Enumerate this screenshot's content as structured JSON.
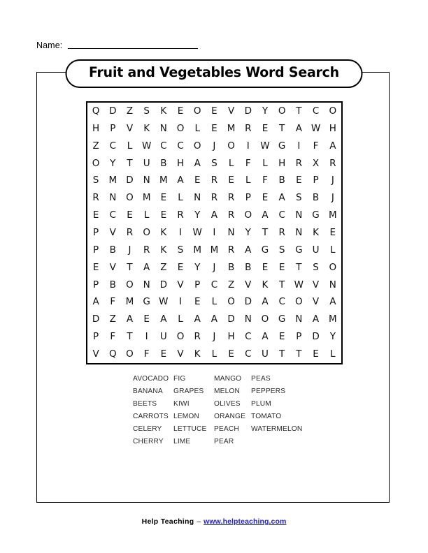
{
  "name_field": {
    "label": "Name:",
    "value": ""
  },
  "title": "Fruit and Vegetables Word Search",
  "grid": {
    "rows": 15,
    "cols": 15,
    "letters": [
      [
        "Q",
        "D",
        "Z",
        "S",
        "K",
        "E",
        "O",
        "E",
        "V",
        "D",
        "Y",
        "O",
        "T",
        "C",
        "O"
      ],
      [
        "H",
        "P",
        "V",
        "K",
        "N",
        "O",
        "L",
        "E",
        "M",
        "R",
        "E",
        "T",
        "A",
        "W",
        "H"
      ],
      [
        "Z",
        "C",
        "L",
        "W",
        "C",
        "C",
        "O",
        "J",
        "O",
        "I",
        "W",
        "G",
        "I",
        "F",
        "A"
      ],
      [
        "O",
        "Y",
        "T",
        "U",
        "B",
        "H",
        "A",
        "S",
        "L",
        "F",
        "L",
        "H",
        "R",
        "X",
        "R"
      ],
      [
        "S",
        "M",
        "D",
        "N",
        "M",
        "A",
        "E",
        "R",
        "E",
        "L",
        "F",
        "B",
        "E",
        "P",
        "J"
      ],
      [
        "R",
        "N",
        "O",
        "M",
        "E",
        "L",
        "N",
        "R",
        "R",
        "P",
        "E",
        "A",
        "S",
        "B",
        "J"
      ],
      [
        "E",
        "C",
        "E",
        "L",
        "E",
        "R",
        "Y",
        "A",
        "R",
        "O",
        "A",
        "C",
        "N",
        "G",
        "M"
      ],
      [
        "P",
        "V",
        "R",
        "O",
        "K",
        "I",
        "W",
        "I",
        "N",
        "Y",
        "T",
        "R",
        "N",
        "K",
        "E"
      ],
      [
        "P",
        "B",
        "J",
        "R",
        "K",
        "S",
        "M",
        "M",
        "R",
        "A",
        "G",
        "S",
        "G",
        "U",
        "L"
      ],
      [
        "E",
        "V",
        "T",
        "A",
        "Z",
        "E",
        "Y",
        "J",
        "B",
        "B",
        "E",
        "E",
        "T",
        "S",
        "O"
      ],
      [
        "P",
        "B",
        "O",
        "N",
        "D",
        "V",
        "P",
        "C",
        "Z",
        "V",
        "K",
        "T",
        "W",
        "V",
        "N"
      ],
      [
        "A",
        "F",
        "M",
        "G",
        "W",
        "I",
        "E",
        "L",
        "O",
        "D",
        "A",
        "C",
        "O",
        "V",
        "A"
      ],
      [
        "D",
        "Z",
        "A",
        "E",
        "A",
        "L",
        "A",
        "A",
        "D",
        "N",
        "O",
        "G",
        "N",
        "A",
        "M"
      ],
      [
        "P",
        "F",
        "T",
        "I",
        "U",
        "O",
        "R",
        "J",
        "H",
        "C",
        "A",
        "E",
        "P",
        "D",
        "Y"
      ],
      [
        "V",
        "Q",
        "O",
        "F",
        "E",
        "V",
        "K",
        "L",
        "E",
        "C",
        "U",
        "T",
        "T",
        "E",
        "L"
      ]
    ]
  },
  "word_list": {
    "rows": [
      [
        "AVOCADO",
        "FIG",
        "MANGO",
        "PEAS"
      ],
      [
        "BANANA",
        "GRAPES",
        "MELON",
        "PEPPERS"
      ],
      [
        "BEETS",
        "KIWI",
        "OLIVES",
        "PLUM"
      ],
      [
        "CARROTS",
        "LEMON",
        "ORANGE",
        "TOMATO"
      ],
      [
        "CELERY",
        "LETTUCE",
        "PEACH",
        "WATERMELON"
      ],
      [
        "CHERRY",
        "LIME",
        "PEAR",
        ""
      ]
    ]
  },
  "footer": {
    "brand": "Help Teaching",
    "dash": "–",
    "link": "www.helpteaching.com",
    "link_color": "#2222dd"
  }
}
